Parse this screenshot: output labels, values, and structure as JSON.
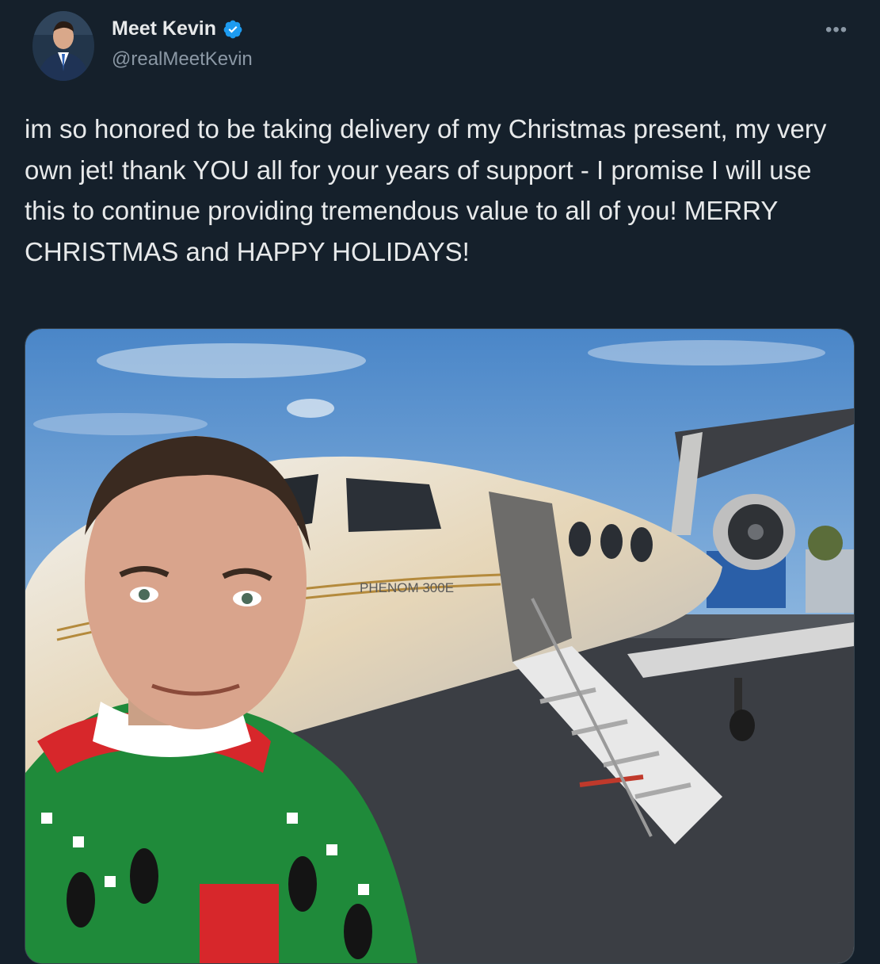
{
  "author": {
    "display_name": "Meet Kevin",
    "handle": "@realMeetKevin",
    "verified": true,
    "avatar_icon": "avatar-man-suit"
  },
  "tweet": {
    "text": "im so honored to be taking delivery of my Christmas present, my very own jet! thank YOU all for your years of support - I promise I will use this to continue providing tremendous value to all of you! MERRY CHRISTMAS and HAPPY HOLIDAYS!"
  },
  "menu": {
    "more_label": "•••"
  },
  "media": {
    "description_icon": "selfie-photo",
    "jet_marking": "PHENOM 300E"
  },
  "colors": {
    "background": "#15202b",
    "text": "#e7e9ea",
    "secondary": "#8b98a5",
    "verified_blue": "#1d9bf0"
  }
}
